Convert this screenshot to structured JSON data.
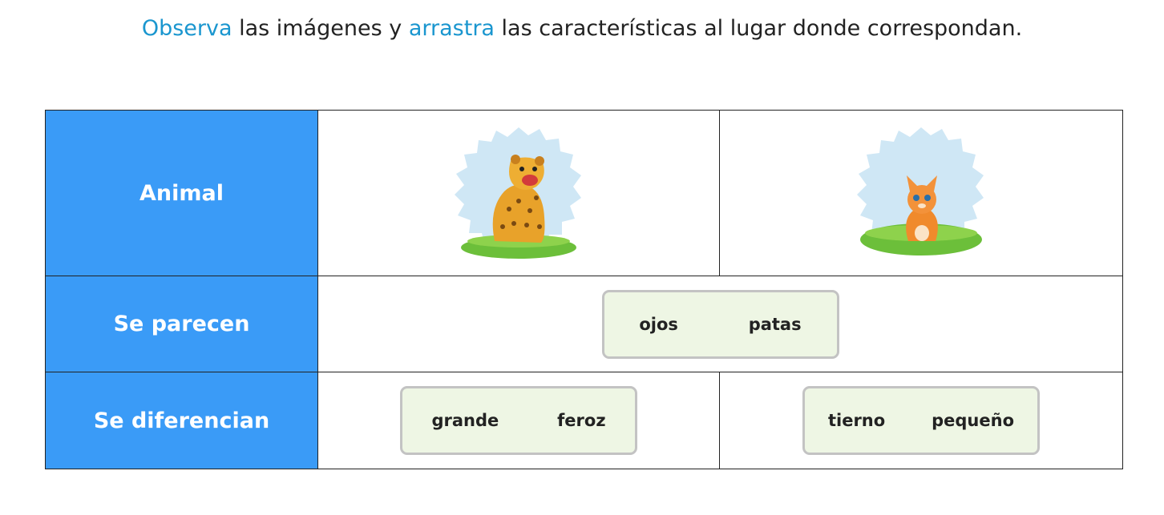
{
  "instruction": {
    "w1": "Observa",
    "t1": " las imágenes y ",
    "w2": "arrastra",
    "t2": " las características al lugar donde correspondan."
  },
  "rows": {
    "animal": "Animal",
    "similar": "Se parecen",
    "different": "Se diferencian"
  },
  "images": {
    "left": "jaguar-illustration",
    "right": "kitten-illustration"
  },
  "similar_chips": [
    "ojos",
    "patas"
  ],
  "left_diff_chips": [
    "grande",
    "feroz"
  ],
  "right_diff_chips": [
    "tierno",
    "pequeño"
  ],
  "colors": {
    "header_bg": "#3a9bf7",
    "highlight": "#1a96cf",
    "dropbox_bg": "#eef6e4"
  }
}
